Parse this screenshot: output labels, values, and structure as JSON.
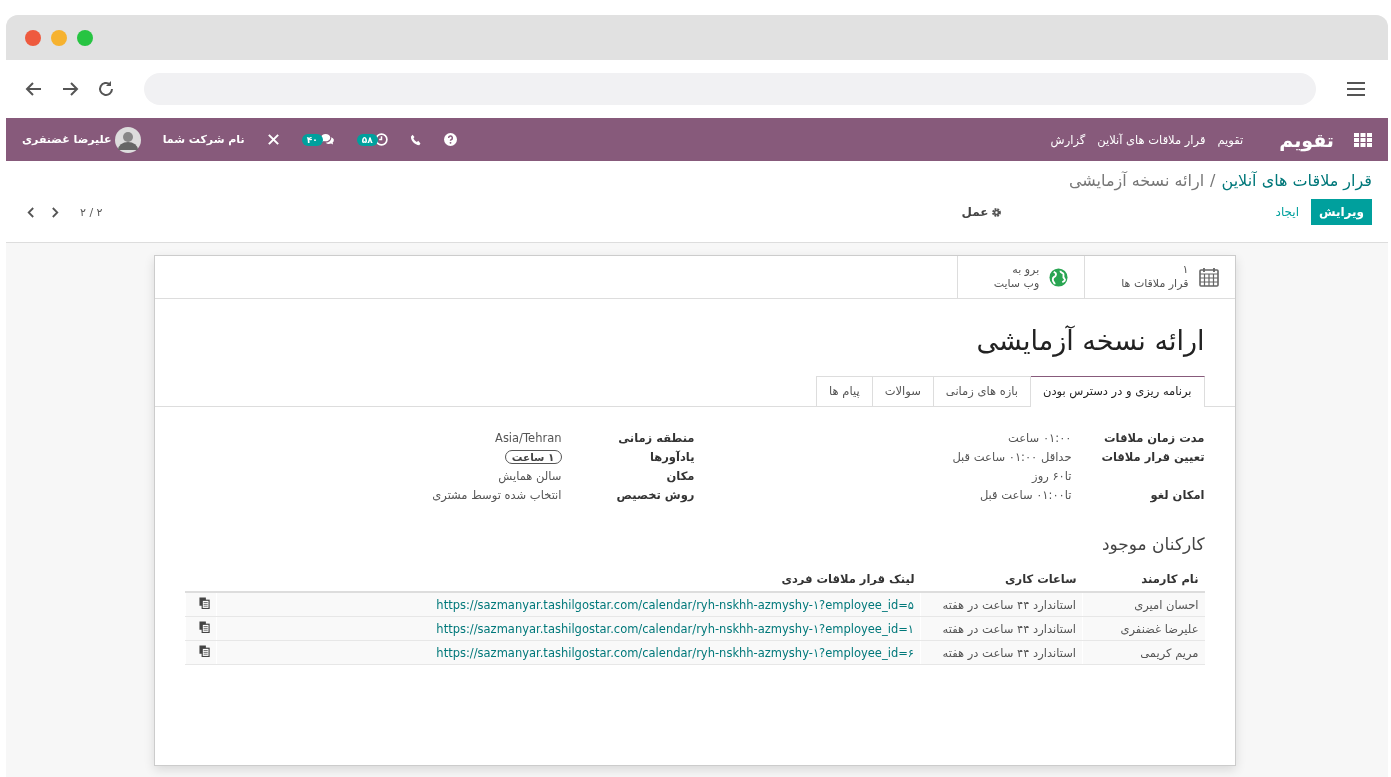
{
  "navbar": {
    "brand": "تقویم",
    "menu": [
      "تقویم",
      "قرار ملاقات های آنلاین",
      "گزارش"
    ],
    "activity_count": "۵۸",
    "message_count": "۴۰",
    "company": "نام شرکت شما",
    "user": "علیرضا غضنفری"
  },
  "breadcrumb": {
    "parent": "قرار ملاقات های آنلاین",
    "separator": "/",
    "current": "ارائه نسخه آزمایشی"
  },
  "buttons": {
    "edit": "ویرایش",
    "create": "ایجاد",
    "action": "عمل",
    "pager": "۲ / ۲"
  },
  "smart_buttons": [
    {
      "kind": "calendar",
      "value": "۱",
      "label": "قرار ملاقات ها"
    },
    {
      "kind": "globe",
      "value": "برو به",
      "label": "وب سایت"
    }
  ],
  "title": "ارائه نسخه آزمایشی",
  "tabs": [
    {
      "label": "برنامه ریزی و در دسترس بودن",
      "selected": true
    },
    {
      "label": "بازه های زمانی",
      "selected": false
    },
    {
      "label": "سوالات",
      "selected": false
    },
    {
      "label": "پیام ها",
      "selected": false
    }
  ],
  "field_groups": [
    [
      {
        "label": "مدت زمان ملاقات",
        "kind": "text",
        "values": [
          "۰۱:۰۰ ساعت"
        ]
      },
      {
        "label": "تعیین قرار ملاقات",
        "kind": "text",
        "values": [
          "حداقل ۰۱:۰۰ ساعت قبل",
          "تا۶۰ روز"
        ]
      },
      {
        "label": "امکان لغو",
        "kind": "text",
        "values": [
          "تا۰۱:۰۰ ساعت قبل"
        ]
      }
    ],
    [
      {
        "label": "منطقه زمانی",
        "kind": "text",
        "values": [
          "Asia/Tehran"
        ]
      },
      {
        "label": "یادآورها",
        "kind": "tag",
        "values": [
          "۱ ساعت"
        ]
      },
      {
        "label": "مکان",
        "kind": "text",
        "values": [
          "سالن همایش"
        ]
      },
      {
        "label": "روش تخصیص",
        "kind": "text",
        "values": [
          "انتخاب شده توسط مشتری"
        ]
      }
    ]
  ],
  "staff": {
    "title": "کارکنان موجود",
    "columns": [
      "نام کارمند",
      "ساعات کاری",
      "لینک قرار ملاقات فردی"
    ],
    "rows": [
      [
        "احسان امیری",
        "استاندارد ۴۴ ساعت در هفته",
        "https://sazmanyar.tashilgostar.com/calendar/ryh-nskhh-azmyshy-۱?employee_id=۵"
      ],
      [
        "علیرضا غضنفری",
        "استاندارد ۴۴ ساعت در هفته",
        "https://sazmanyar.tashilgostar.com/calendar/ryh-nskhh-azmyshy-۱?employee_id=۱"
      ],
      [
        "مریم کریمی",
        "استاندارد ۴۴ ساعت در هفته",
        "https://sazmanyar.tashilgostar.com/calendar/ryh-nskhh-azmyshy-۱?employee_id=۶"
      ]
    ]
  }
}
